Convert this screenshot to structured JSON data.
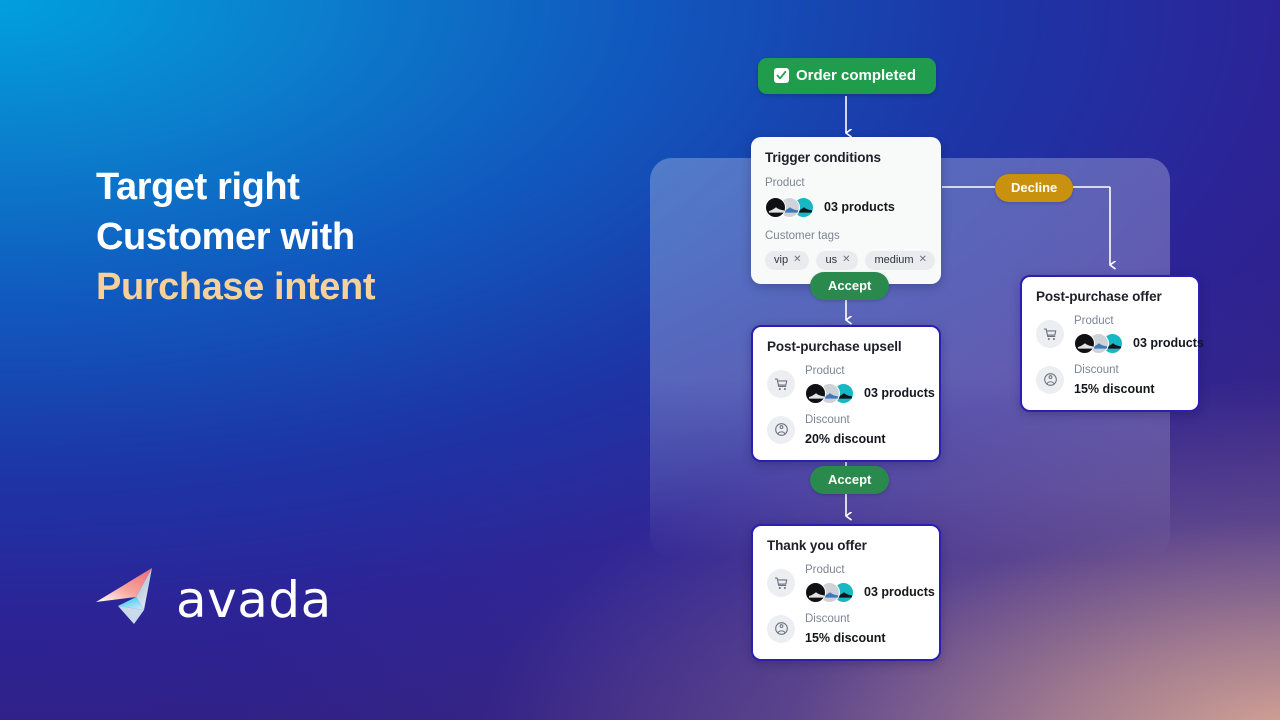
{
  "headline": {
    "line1": "Target right",
    "line2": "Customer with",
    "line3": "Purchase intent",
    "accent_color": "#f6d19a"
  },
  "brand": {
    "name": "avada",
    "logo_icon": "avada-paper-plane-icon"
  },
  "flow": {
    "start_badge": {
      "label": "Order completed",
      "icon": "check-icon",
      "color": "#1f9d4d"
    },
    "branch_labels": {
      "accept_1": "Accept",
      "accept_2": "Accept",
      "decline": "Decline",
      "accept_color": "#2a8a4e",
      "decline_color": "#c8920f"
    },
    "trigger_card": {
      "title": "Trigger conditions",
      "product_label": "Product",
      "product_value": "03 products",
      "tags_label": "Customer tags",
      "tags": [
        "vip",
        "us",
        "medium"
      ]
    },
    "upsell_card": {
      "title": "Post-purchase upsell",
      "product_label": "Product",
      "product_value": "03 products",
      "discount_label": "Discount",
      "discount_value": "20% discount",
      "product_icon": "cart-icon",
      "discount_icon": "discount-tag-icon"
    },
    "thankyou_card": {
      "title": "Thank you offer",
      "product_label": "Product",
      "product_value": "03 products",
      "discount_label": "Discount",
      "discount_value": "15% discount",
      "product_icon": "cart-icon",
      "discount_icon": "discount-tag-icon"
    },
    "offer_card": {
      "title": "Post-purchase offer",
      "product_label": "Product",
      "product_value": "03 products",
      "discount_label": "Discount",
      "discount_value": "15% discount",
      "product_icon": "cart-icon",
      "discount_icon": "discount-tag-icon"
    }
  }
}
